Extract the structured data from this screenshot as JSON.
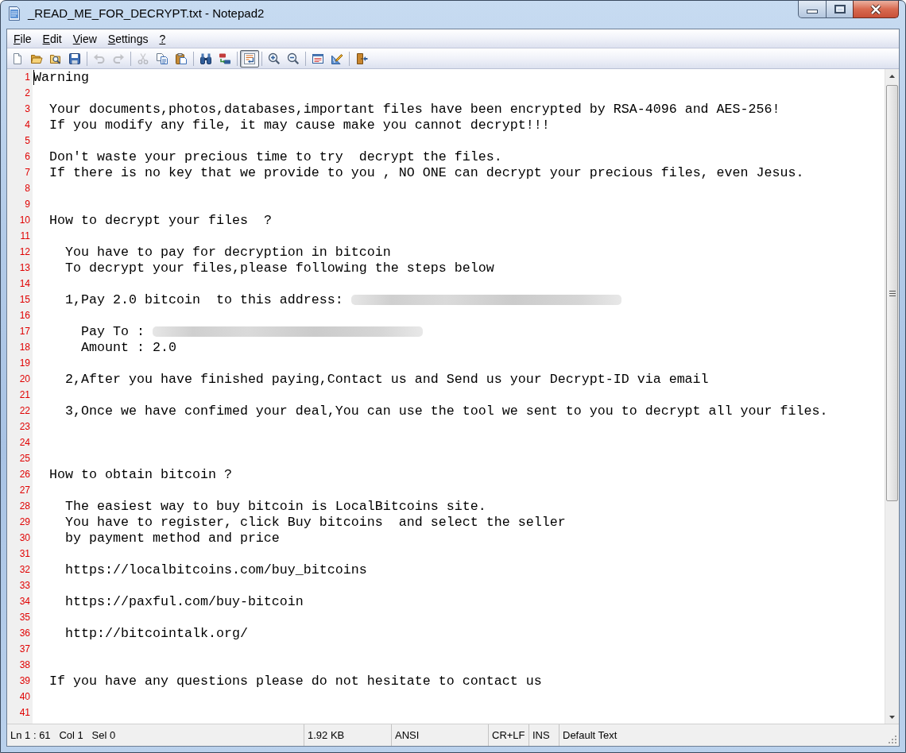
{
  "window": {
    "title": "_READ_ME_FOR_DECRYPT.txt - Notepad2"
  },
  "menu": [
    {
      "label": "File"
    },
    {
      "label": "Edit"
    },
    {
      "label": "View"
    },
    {
      "label": "Settings"
    },
    {
      "label": "?"
    }
  ],
  "toolbar": [
    {
      "kind": "button",
      "disabled": false,
      "selected": false
    },
    {
      "kind": "button",
      "disabled": false,
      "selected": false
    },
    {
      "kind": "button",
      "disabled": false,
      "selected": false
    },
    {
      "kind": "button",
      "disabled": false,
      "selected": false
    },
    {
      "kind": "separator"
    },
    {
      "kind": "button",
      "disabled": true,
      "selected": false
    },
    {
      "kind": "button",
      "disabled": true,
      "selected": false
    },
    {
      "kind": "separator"
    },
    {
      "kind": "button",
      "disabled": true,
      "selected": false
    },
    {
      "kind": "button",
      "disabled": false,
      "selected": false
    },
    {
      "kind": "button",
      "disabled": false,
      "selected": false
    },
    {
      "kind": "separator"
    },
    {
      "kind": "button",
      "disabled": false,
      "selected": false
    },
    {
      "kind": "button",
      "disabled": false,
      "selected": false
    },
    {
      "kind": "separator"
    },
    {
      "kind": "button",
      "disabled": false,
      "selected": true
    },
    {
      "kind": "separator"
    },
    {
      "kind": "button",
      "disabled": false,
      "selected": false
    },
    {
      "kind": "button",
      "disabled": false,
      "selected": false
    },
    {
      "kind": "separator"
    },
    {
      "kind": "button",
      "disabled": false,
      "selected": false
    },
    {
      "kind": "button",
      "disabled": false,
      "selected": false
    },
    {
      "kind": "separator"
    },
    {
      "kind": "button",
      "disabled": false,
      "selected": false
    }
  ],
  "editor": {
    "lines": [
      {
        "number": "1",
        "text": "Warning",
        "cursor": true,
        "redacted": false
      },
      {
        "number": "2",
        "cursor": false,
        "redacted": false
      },
      {
        "number": "3",
        "text": "  Your documents,photos,databases,important files have been encrypted by RSA-4096 and AES-256!",
        "cursor": false,
        "redacted": false
      },
      {
        "number": "4",
        "text": "  If you modify any file, it may cause make you cannot decrypt!!!",
        "cursor": false,
        "redacted": false
      },
      {
        "number": "5",
        "cursor": false,
        "redacted": false
      },
      {
        "number": "6",
        "text": "  Don't waste your precious time to try  decrypt the files.",
        "cursor": false,
        "redacted": false
      },
      {
        "number": "7",
        "text": "  If there is no key that we provide to you , NO ONE can decrypt your precious files, even Jesus.",
        "cursor": false,
        "redacted": false
      },
      {
        "number": "8",
        "cursor": false,
        "redacted": false
      },
      {
        "number": "9",
        "cursor": false,
        "redacted": false
      },
      {
        "number": "10",
        "text": "  How to decrypt your files  ?",
        "cursor": false,
        "redacted": false
      },
      {
        "number": "11",
        "cursor": false,
        "redacted": false
      },
      {
        "number": "12",
        "text": "    You have to pay for decryption in bitcoin",
        "cursor": false,
        "redacted": false
      },
      {
        "number": "13",
        "text": "    To decrypt your files,please following the steps below",
        "cursor": false,
        "redacted": false
      },
      {
        "number": "14",
        "cursor": false,
        "redacted": false
      },
      {
        "number": "15",
        "text": "    1,Pay 2.0 bitcoin  to this address:",
        "cursor": false,
        "redacted": true
      },
      {
        "number": "16",
        "cursor": false,
        "redacted": false
      },
      {
        "number": "17",
        "text": "      Pay To :",
        "cursor": false,
        "redacted": true
      },
      {
        "number": "18",
        "text": "      Amount : 2.0",
        "cursor": false,
        "redacted": false
      },
      {
        "number": "19",
        "cursor": false,
        "redacted": false
      },
      {
        "number": "20",
        "text": "    2,After you have finished paying,Contact us and Send us your Decrypt-ID via email",
        "cursor": false,
        "redacted": false
      },
      {
        "number": "21",
        "cursor": false,
        "redacted": false
      },
      {
        "number": "22",
        "text": "    3,Once we have confimed your deal,You can use the tool we sent to you to decrypt all your files.",
        "cursor": false,
        "redacted": false
      },
      {
        "number": "23",
        "cursor": false,
        "redacted": false
      },
      {
        "number": "24",
        "cursor": false,
        "redacted": false
      },
      {
        "number": "25",
        "cursor": false,
        "redacted": false
      },
      {
        "number": "26",
        "text": "  How to obtain bitcoin ?",
        "cursor": false,
        "redacted": false
      },
      {
        "number": "27",
        "cursor": false,
        "redacted": false
      },
      {
        "number": "28",
        "text": "    The easiest way to buy bitcoin is LocalBitcoins site.",
        "cursor": false,
        "redacted": false
      },
      {
        "number": "29",
        "text": "    You have to register, click Buy bitcoins  and select the seller",
        "cursor": false,
        "redacted": false
      },
      {
        "number": "30",
        "text": "    by payment method and price",
        "cursor": false,
        "redacted": false
      },
      {
        "number": "31",
        "cursor": false,
        "redacted": false
      },
      {
        "number": "32",
        "text": "    https://localbitcoins.com/buy_bitcoins",
        "cursor": false,
        "redacted": false
      },
      {
        "number": "33",
        "cursor": false,
        "redacted": false
      },
      {
        "number": "34",
        "text": "    https://paxful.com/buy-bitcoin",
        "cursor": false,
        "redacted": false
      },
      {
        "number": "35",
        "cursor": false,
        "redacted": false
      },
      {
        "number": "36",
        "text": "    http://bitcointalk.org/",
        "cursor": false,
        "redacted": false
      },
      {
        "number": "37",
        "cursor": false,
        "redacted": false
      },
      {
        "number": "38",
        "cursor": false,
        "redacted": false
      },
      {
        "number": "39",
        "text": "  If you have any questions please do not hesitate to contact us",
        "cursor": false,
        "redacted": false
      },
      {
        "number": "40",
        "cursor": false,
        "redacted": false
      },
      {
        "number": "41",
        "cursor": false,
        "redacted": false
      }
    ]
  },
  "status_bar": [
    "Ln 1 : 61   Col 1   Sel 0",
    "1.92 KB",
    "ANSI",
    "CR+LF",
    "INS",
    "Default Text"
  ]
}
